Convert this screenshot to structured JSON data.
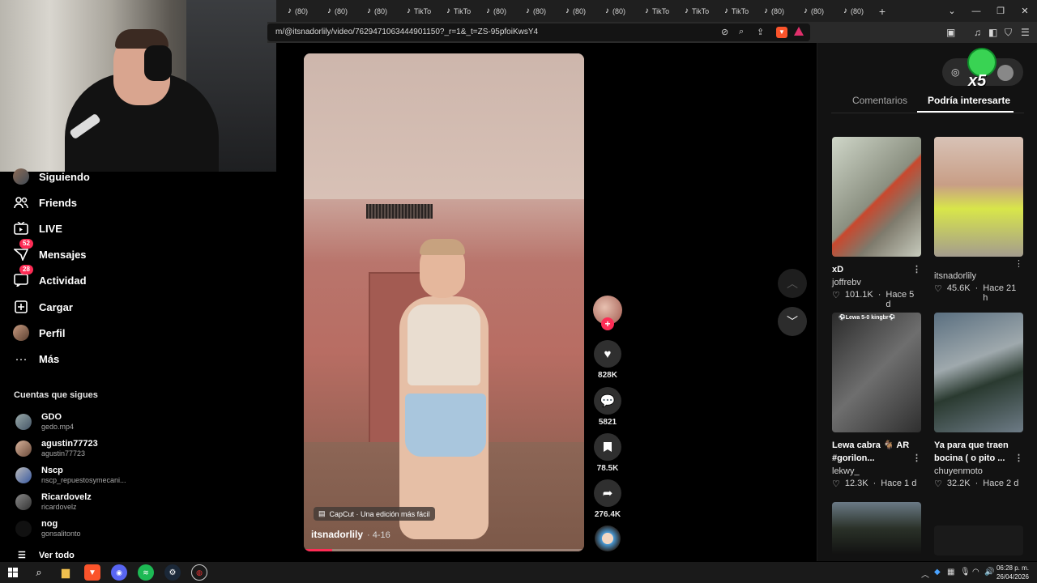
{
  "browser": {
    "tabs": [
      {
        "label": "(80)"
      },
      {
        "label": "(80)"
      },
      {
        "label": "(80)"
      },
      {
        "label": "TikTo"
      },
      {
        "label": "TikTo"
      },
      {
        "label": "(80)"
      },
      {
        "label": "(80)"
      },
      {
        "label": "(80)"
      },
      {
        "label": "(80)"
      },
      {
        "label": "TikTo"
      },
      {
        "label": "TikTo"
      },
      {
        "label": "TikTo"
      },
      {
        "label": "(80)"
      },
      {
        "label": "(80)"
      },
      {
        "label": "(80)"
      }
    ],
    "new_tab": "+",
    "url": "m/@itsnadorlily/video/7629471063444901150?_r=1&_t=ZS-95pfoiKwsY4"
  },
  "sidebar": {
    "items": [
      {
        "label": "Siguiendo",
        "icon": "following-avatar-icon"
      },
      {
        "label": "Friends",
        "icon": "friends-icon"
      },
      {
        "label": "LIVE",
        "icon": "live-icon"
      },
      {
        "label": "Mensajes",
        "icon": "messages-icon",
        "badge": "52"
      },
      {
        "label": "Actividad",
        "icon": "activity-icon",
        "badge": "28"
      },
      {
        "label": "Cargar",
        "icon": "upload-icon"
      },
      {
        "label": "Perfil",
        "icon": "profile-avatar-icon"
      },
      {
        "label": "Más",
        "icon": "more-icon"
      }
    ],
    "following_title": "Cuentas que sigues",
    "accounts": [
      {
        "name": "GDO",
        "handle": "gedo.mp4"
      },
      {
        "name": "agustin77723",
        "handle": "agustin77723"
      },
      {
        "name": "Nscp",
        "handle": "nscp_repuestosymecani..."
      },
      {
        "name": "Ricardovelz",
        "handle": "ricardovelz"
      },
      {
        "name": "nog",
        "handle": "gonsalitonto"
      }
    ],
    "see_all": "Ver todo"
  },
  "video": {
    "author": "itsnadorlily",
    "date": "· 4-16",
    "capcut": "CapCut · Una edición más fácil",
    "progress": 0.1
  },
  "actions": {
    "likes": "828K",
    "comments": "5821",
    "saves": "78.5K",
    "shares": "276.4K"
  },
  "panel": {
    "badge": "x5",
    "tabs": {
      "comments": "Comentarios",
      "foryou": "Podría interesarte"
    },
    "cards": [
      {
        "title": "xD",
        "author": "joffrebv",
        "likes": "101.1K",
        "time": "Hace 5 d"
      },
      {
        "title": "",
        "author": "itsnadorlily",
        "likes": "45.6K",
        "time": "Hace 21 h"
      },
      {
        "title": "Lewa cabra 🐐 AR #gorilon...",
        "author": "lekwy_",
        "likes": "12.3K",
        "time": "Hace 1 d",
        "overlay": "⚽Lewa 5-0 kingbr⚽"
      },
      {
        "title": "Ya para que traen bocina ( o pito ...",
        "author": "chuyenmoto",
        "likes": "32.2K",
        "time": "Hace 2 d"
      }
    ]
  },
  "taskbar": {
    "time": "06:28 p. m.",
    "date": "26/04/2026"
  }
}
